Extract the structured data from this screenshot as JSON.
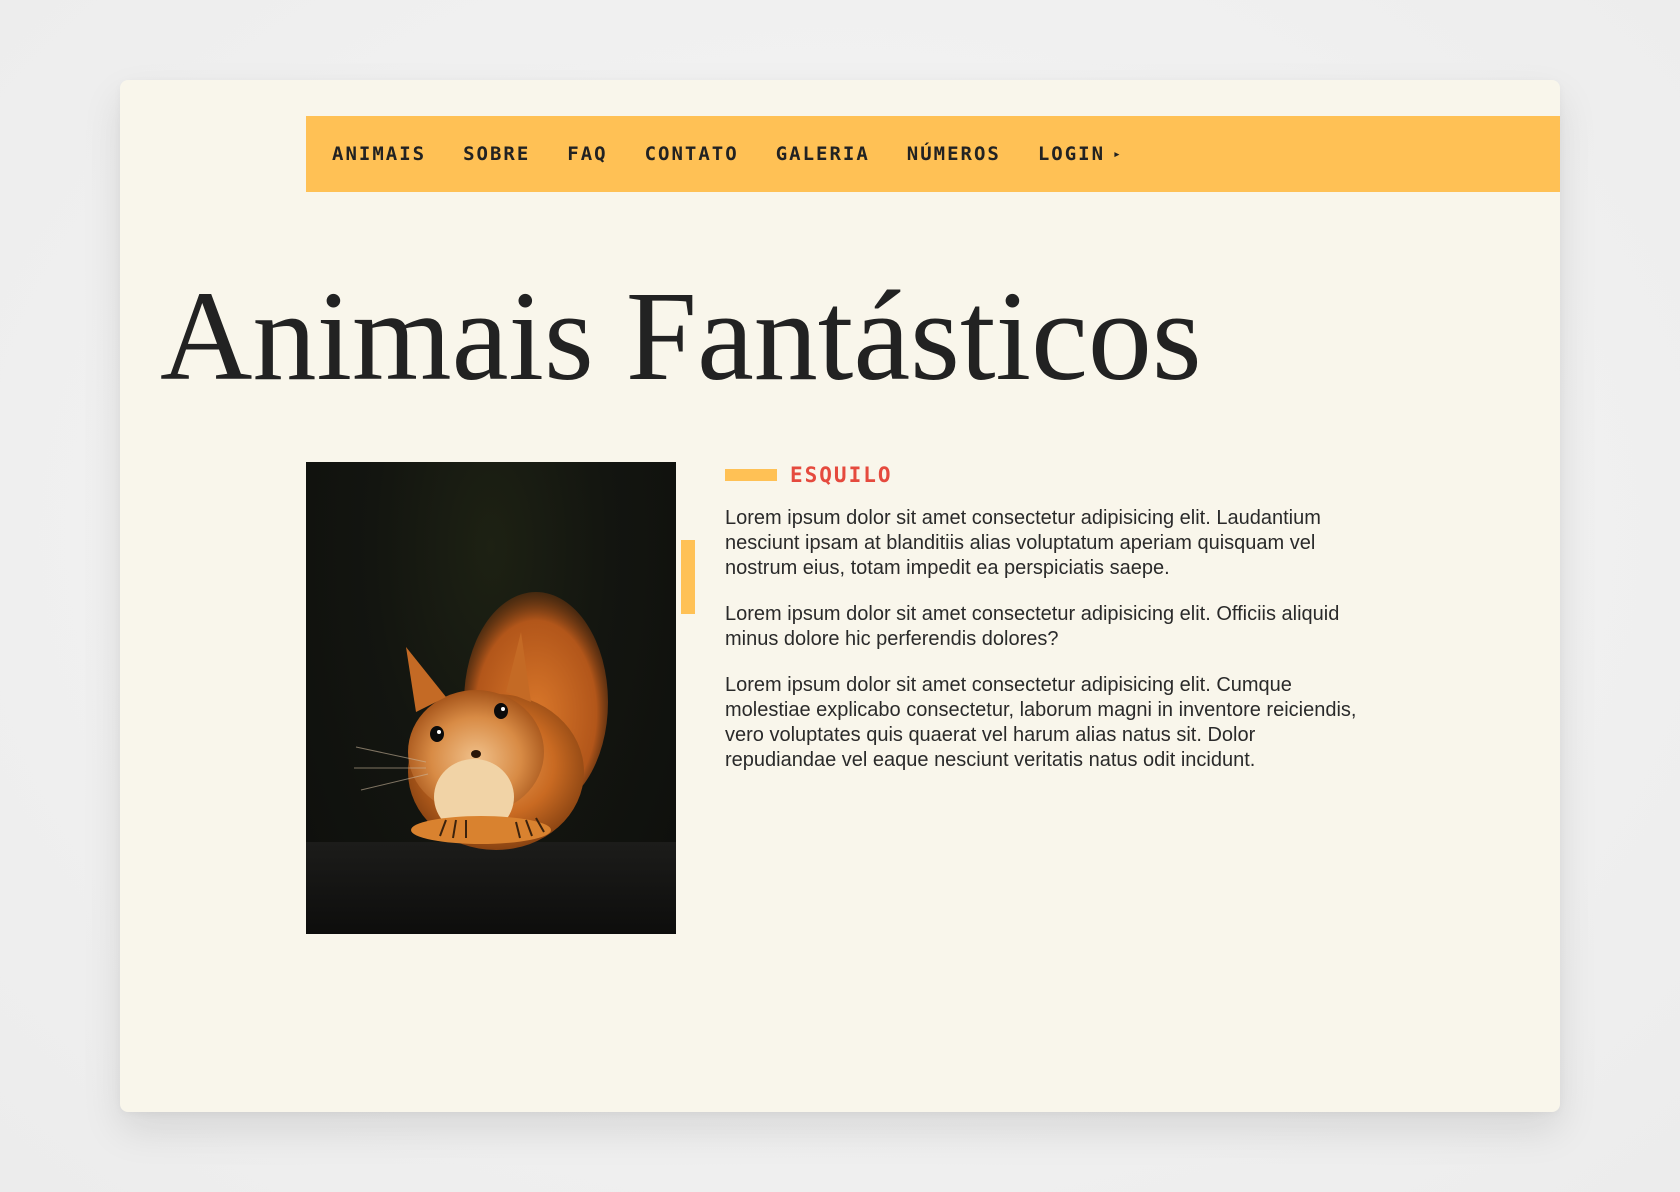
{
  "nav": {
    "items": [
      {
        "label": "ANIMAIS"
      },
      {
        "label": "SOBRE"
      },
      {
        "label": "FAQ"
      },
      {
        "label": "CONTATO"
      },
      {
        "label": "GALERIA"
      },
      {
        "label": "NÚMEROS"
      },
      {
        "label": "LOGIN"
      }
    ],
    "login_arrow": "▸"
  },
  "page": {
    "title": "Animais Fantásticos"
  },
  "animal": {
    "name": "ESQUILO",
    "paragraphs": [
      "Lorem ipsum dolor sit amet consectetur adipisicing elit. Laudantium nesciunt ipsam at blanditiis alias voluptatum aperiam quisquam vel nostrum eius, totam impedit ea perspiciatis saepe.",
      "Lorem ipsum dolor sit amet consectetur adipisicing elit. Officiis aliquid minus dolore hic perferendis dolores?",
      "Lorem ipsum dolor sit amet consectetur adipisicing elit. Cumque molestiae explicabo consectetur, laborum magni in inventore reiciendis, vero voluptates quis quaerat vel harum alias natus sit. Dolor repudiandae vel eaque nesciunt veritatis natus odit incidunt."
    ]
  },
  "colors": {
    "accent": "#ffc155",
    "highlight": "#e54a3e",
    "background": "#f9f6eb",
    "text": "#222222"
  }
}
